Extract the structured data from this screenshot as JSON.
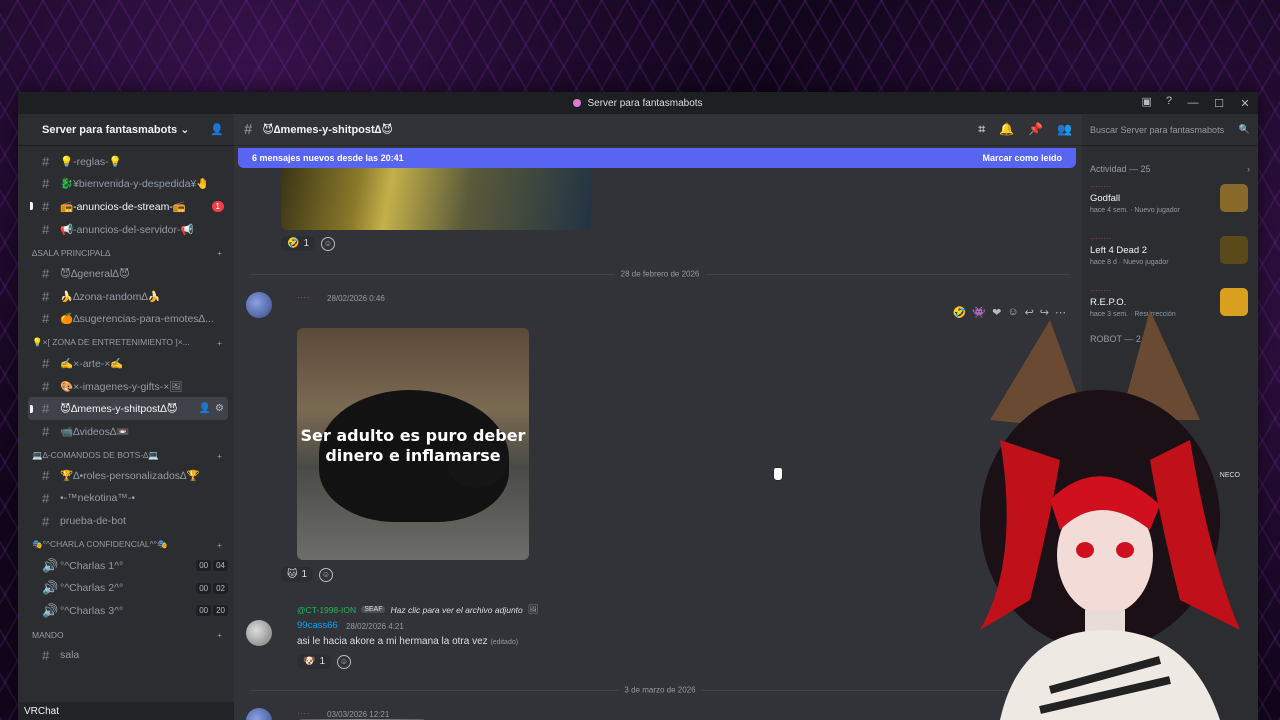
{
  "window": {
    "title": "Server para fantasmabots"
  },
  "sidebar": {
    "server_name": "Server para fantasmabots",
    "channels": [
      {
        "name": "💡-reglas-💡",
        "unread": false
      },
      {
        "name": "🐉¥bienvenida-y-despedida¥🤚",
        "unread": false
      },
      {
        "name": "📻-anuncios-de-stream-📻",
        "unread": true,
        "badge": "1"
      },
      {
        "name": "📢-anuncios-del-servidor-📢",
        "unread": false
      }
    ],
    "cat_sala": "∆SALA PRINCIPAL∆",
    "sala_channels": [
      {
        "name": "😈∆general∆😈"
      },
      {
        "name": "🍌∆zona-random∆🍌"
      },
      {
        "name": "🍊∆sugerencias-para-emotes∆..."
      }
    ],
    "cat_entretenimiento": "💡×[ ZONA DE ENTRETENIMIENTO ]×...",
    "ent_channels": [
      {
        "name": "✍️×-arte-×✍️"
      },
      {
        "name": "🎨×-imagenes-y-gifts-×🖼"
      },
      {
        "name": "😈∆memes-y-shitpost∆😈"
      },
      {
        "name": "📹∆videos∆📼"
      }
    ],
    "cat_bots": "💻∆-COMANDOS DE BOTS-∆💻",
    "bot_channels": [
      {
        "name": "🏆∆•roles-personalizados∆🏆"
      },
      {
        "name": "•-™nekotina™-•"
      },
      {
        "name": "prueba-de-bot"
      }
    ],
    "cat_charla": "🎭°^CHARLA CONFIDENCIAL^°🎭",
    "voice_channels": [
      {
        "name": "°^Charlas 1^°",
        "a": "00",
        "b": "04"
      },
      {
        "name": "°^Charlas 2^°",
        "a": "00",
        "b": "02"
      },
      {
        "name": "°^Charlas 3^°",
        "a": "00",
        "b": "20"
      }
    ],
    "cat_mando": "MANDO",
    "mando_channels": [
      {
        "name": "sala"
      }
    ],
    "user_bar": "VRChat"
  },
  "main": {
    "channel_name": "😈∆memes-y-shitpost∆😈",
    "new_messages": "6 mensajes nuevos desde las 20:41",
    "mark_read": "Marcar como leído",
    "react1_count": "1",
    "date1": "28 de febrero de 2026",
    "msg1_time": "28/02/2026 0:46",
    "meme_text": "Ser adulto es puro deber dinero e inflamarse",
    "react2_count": "1",
    "reply_user": "@CT-1998-ION",
    "reply_tag": "SEAF",
    "reply_text": "Haz clic para ver el archivo adjunto",
    "msg2_user": "99cass66",
    "msg2_time": "28/02/2026 4:21",
    "msg2_text": "asi le hacia akore a mi hermana la otra vez",
    "msg2_edited": "(editado)",
    "react3_count": "1",
    "date2": "3 de marzo de 2026",
    "msg3_time": "03/03/2026 12:21"
  },
  "members": {
    "search_placeholder": "Buscar Server para fantasmabots",
    "activity": "Actividad — 25",
    "games": [
      {
        "name": "Godfall",
        "meta": "hace 4 sem.",
        "tag": "Nuevo jugador",
        "color": "#8a6a2a"
      },
      {
        "name": "Left 4 Dead 2",
        "meta": "hace 8 d",
        "tag": "Nuevo jugador",
        "color": "#5a4a1a"
      },
      {
        "name": "R.E.P.O.",
        "meta": "hace 3 sem.",
        "tag": "Resurrección",
        "color": "#d9a020"
      }
    ],
    "bot_header": "ROBOT — 2",
    "neco": "NECO"
  }
}
